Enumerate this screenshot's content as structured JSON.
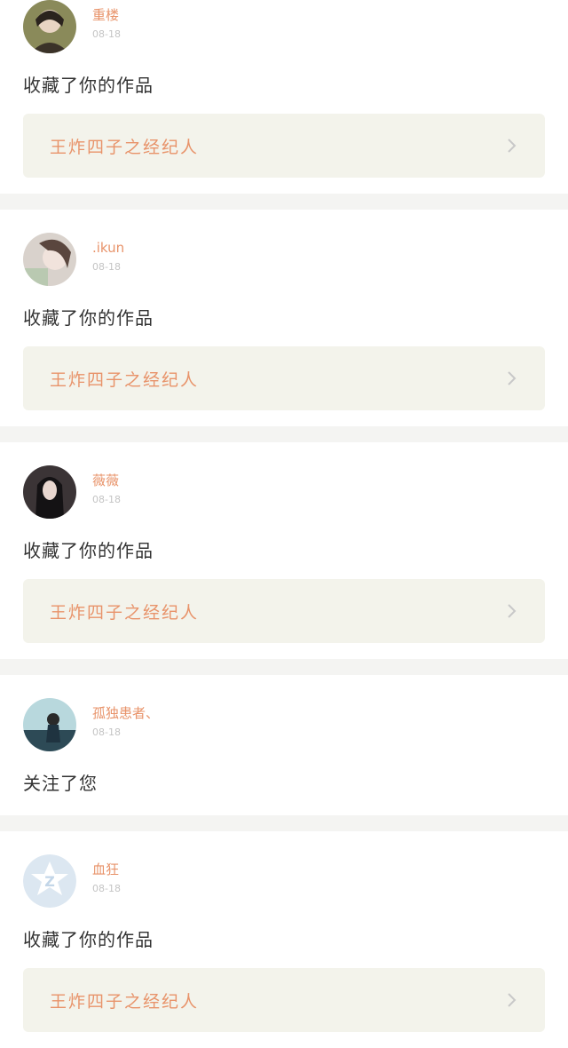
{
  "notifications": [
    {
      "user": "重楼",
      "time": "08-18",
      "action": "收藏了你的作品",
      "work": "王炸四子之经纪人",
      "avatar": "a1"
    },
    {
      "user": ".ikun",
      "time": "08-18",
      "action": "收藏了你的作品",
      "work": "王炸四子之经纪人",
      "avatar": "a2"
    },
    {
      "user": "薇薇",
      "time": "08-18",
      "action": "收藏了你的作品",
      "work": "王炸四子之经纪人",
      "avatar": "a3"
    },
    {
      "user": "孤独患者、",
      "time": "08-18",
      "action": "关注了您",
      "work": "",
      "avatar": "a4"
    },
    {
      "user": "血狂",
      "time": "08-18",
      "action": "收藏了你的作品",
      "work": "王炸四子之经纪人",
      "avatar": "a5"
    }
  ],
  "colors": {
    "accent": "#e8936a",
    "card_bg": "#f3f3eb",
    "page_bg": "#f4f4f2"
  }
}
